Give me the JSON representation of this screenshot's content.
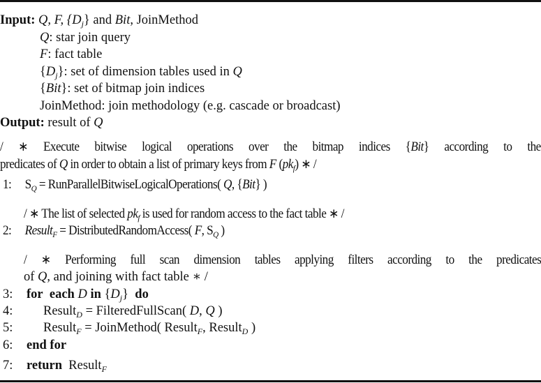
{
  "algorithm": {
    "input_label": "Input:",
    "input_vars": "Q, F, {D",
    "input_and": "} and ",
    "input_bit": "Bit",
    "input_join": ", JoinMethod",
    "inputs": [
      {
        "sym": "Q",
        "desc": ": star join query"
      },
      {
        "sym": "F",
        "desc": ": fact table"
      },
      {
        "sym_pre": "{",
        "sym": "D",
        "sym_sub": "j",
        "sym_post": "}",
        "desc": ": set of dimension tables used in ",
        "desc_q": "Q"
      },
      {
        "sym_pre": "{",
        "sym": "Bit",
        "sym_post": "}",
        "desc": ": set of bitmap join indices"
      },
      {
        "sym": "JoinMethod",
        "desc": ": join methodology (e.g. cascade or broadcast)"
      }
    ],
    "output_label": "Output:",
    "output_text": "result of ",
    "output_q": "Q",
    "comment1_line1_a": "/ ∗ Execute bitwise logical operations over the bitmap indices {",
    "comment1_line1_bit": "Bit",
    "comment1_line1_b": "} according to the",
    "comment1_line2_a": "predicates of ",
    "comment1_line2_q": "Q",
    "comment1_line2_b": " in order to obtain a list of primary keys from ",
    "comment1_line2_f": "F",
    "comment1_line2_c": " (",
    "comment1_line2_pk": "pk",
    "comment1_line2_sub": "f",
    "comment1_line2_d": ") ∗ /",
    "steps": [
      {
        "n": "1:",
        "lhs": "S",
        "lhs_sub": "Q",
        "text": " = RunParallelBitwiseLogicalOperations( ",
        "arg1": "Q",
        "mid": ", {",
        "arg2": "Bit",
        "end": "} )"
      },
      {
        "n": "2:",
        "lhs": "Result",
        "lhs_sub": "F",
        "text": " = DistributedRandomAccess( ",
        "arg1": "F",
        "mid": ", S",
        "arg2_sub": "Q",
        "end": " )"
      },
      {
        "n": "3:",
        "kw1": "for",
        "kw2": "each",
        "var": "D",
        "kw3": "in",
        "set_pre": " {",
        "set": "D",
        "set_sub": "j",
        "set_post": "}",
        "kw4": "do"
      },
      {
        "n": "4:",
        "lhs": "Result",
        "lhs_sub": "D",
        "text": " = FilteredFullScan( ",
        "arg1": "D",
        "mid": ", ",
        "arg2": "Q",
        "end": " )"
      },
      {
        "n": "5:",
        "lhs": "Result",
        "lhs_sub": "F",
        "text": " = JoinMethod( Result",
        "arg1_sub": "F",
        "mid": ", Result",
        "arg2_sub": "D",
        "end": " )"
      },
      {
        "n": "6:",
        "kw": "end for"
      },
      {
        "n": "7:",
        "kw": "return",
        "val": "Result",
        "val_sub": "F"
      }
    ],
    "comment2_a": "/ ∗ The list of selected ",
    "comment2_pk": "pk",
    "comment2_sub": "f",
    "comment2_b": " is used for random access to the fact table ∗ /",
    "comment3_line1": "/ ∗ Performing full scan dimension tables applying filters according to the predicates",
    "comment3_line2_a": "of ",
    "comment3_line2_q": "Q",
    "comment3_line2_b": ", and joining with fact table ∗ /"
  }
}
